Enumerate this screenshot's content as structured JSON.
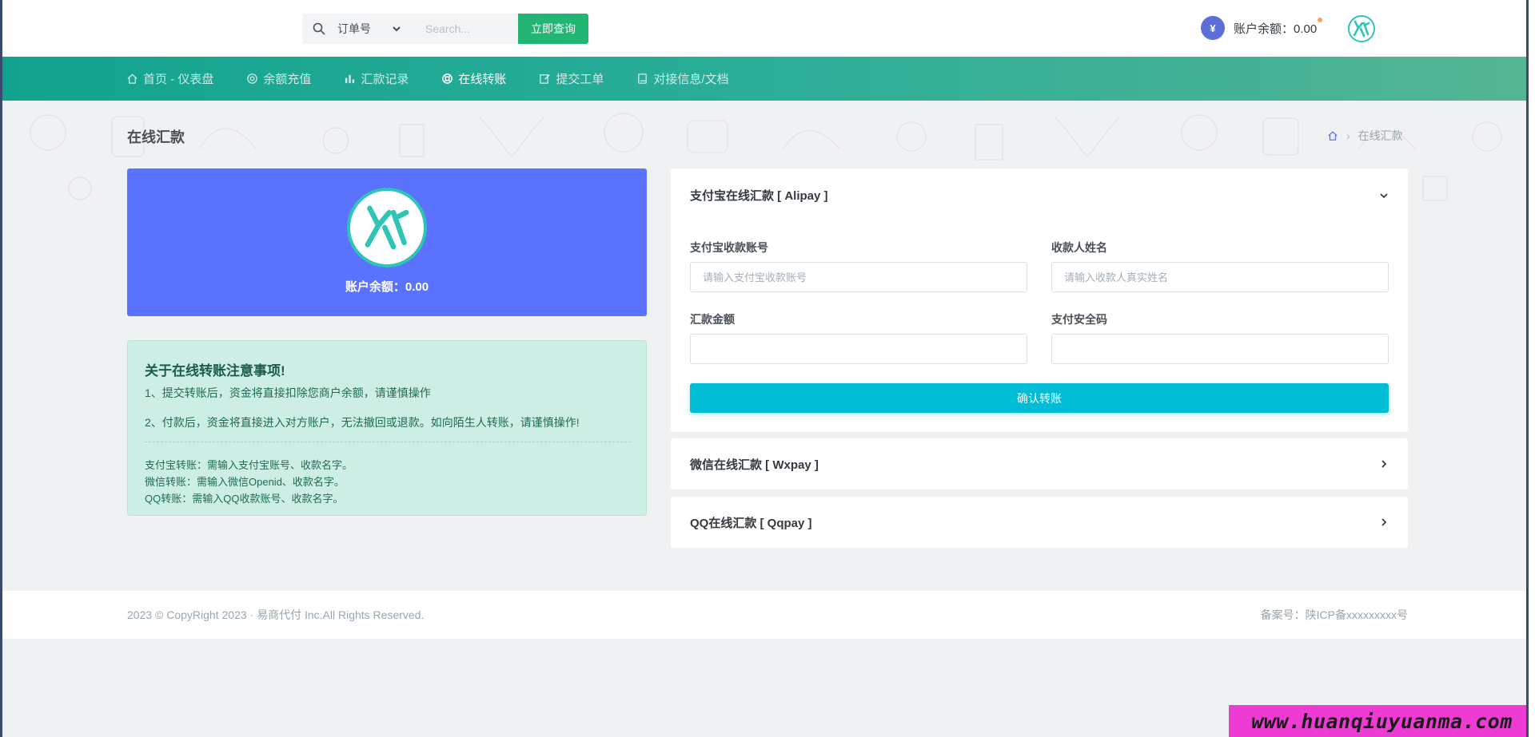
{
  "header": {
    "search": {
      "select_value": "订单号",
      "placeholder": "Search...",
      "button_label": "立即查询"
    },
    "balance_label": "账户余额：0.00"
  },
  "nav": {
    "items": [
      {
        "label": "首页 - 仪表盘",
        "icon": "home-icon"
      },
      {
        "label": "余额充值",
        "icon": "coin-icon"
      },
      {
        "label": "汇款记录",
        "icon": "bar-chart-icon"
      },
      {
        "label": "在线转账",
        "icon": "lifebuoy-icon",
        "active": true
      },
      {
        "label": "提交工单",
        "icon": "edit-icon"
      },
      {
        "label": "对接信息/文档",
        "icon": "book-icon"
      }
    ]
  },
  "page": {
    "title": "在线汇款",
    "breadcrumb": {
      "current": "在线汇款"
    }
  },
  "profile": {
    "balance_label": "账户余额：0.00"
  },
  "notice": {
    "title": "关于在线转账注意事项!",
    "lines": [
      "1、提交转账后，资金将直接扣除您商户余额，请谨慎操作",
      "2、付款后，资金将直接进入对方账户，无法撤回或退款。如向陌生人转账，请谨慎操作!"
    ],
    "details": [
      "支付宝转账：需输入支付宝账号、收款名字。",
      "微信转账：需输入微信Openid、收款名字。",
      "QQ转账：需输入QQ收款账号、收款名字。"
    ]
  },
  "panels": {
    "alipay": {
      "title": "支付宝在线汇款 [ Alipay ]",
      "fields": {
        "account_label": "支付宝收款账号",
        "account_placeholder": "请输入支付宝收款账号",
        "name_label": "收款人姓名",
        "name_placeholder": "请输入收款人真实姓名",
        "amount_label": "汇款金额",
        "amount_value": "",
        "security_label": "支付安全码",
        "security_value": ""
      },
      "submit_label": "确认转账"
    },
    "wxpay": {
      "title": "微信在线汇款 [ Wxpay ]"
    },
    "qqpay": {
      "title": "QQ在线汇款 [ Qqpay ]"
    }
  },
  "footer": {
    "copyright": "2023 © CopyRight 2023 · 易商代付 Inc.All Rights Reserved.",
    "icp": "备案号：陕ICP备xxxxxxxxx号"
  },
  "watermark": "www.huanqiuyuanma.com",
  "colors": {
    "primary_green": "#22b573",
    "nav_start": "#12a38f",
    "nav_end": "#55b593",
    "profile_card": "#5b73fc",
    "submit_button": "#00bcd4",
    "notice_bg": "#cdeee4"
  }
}
